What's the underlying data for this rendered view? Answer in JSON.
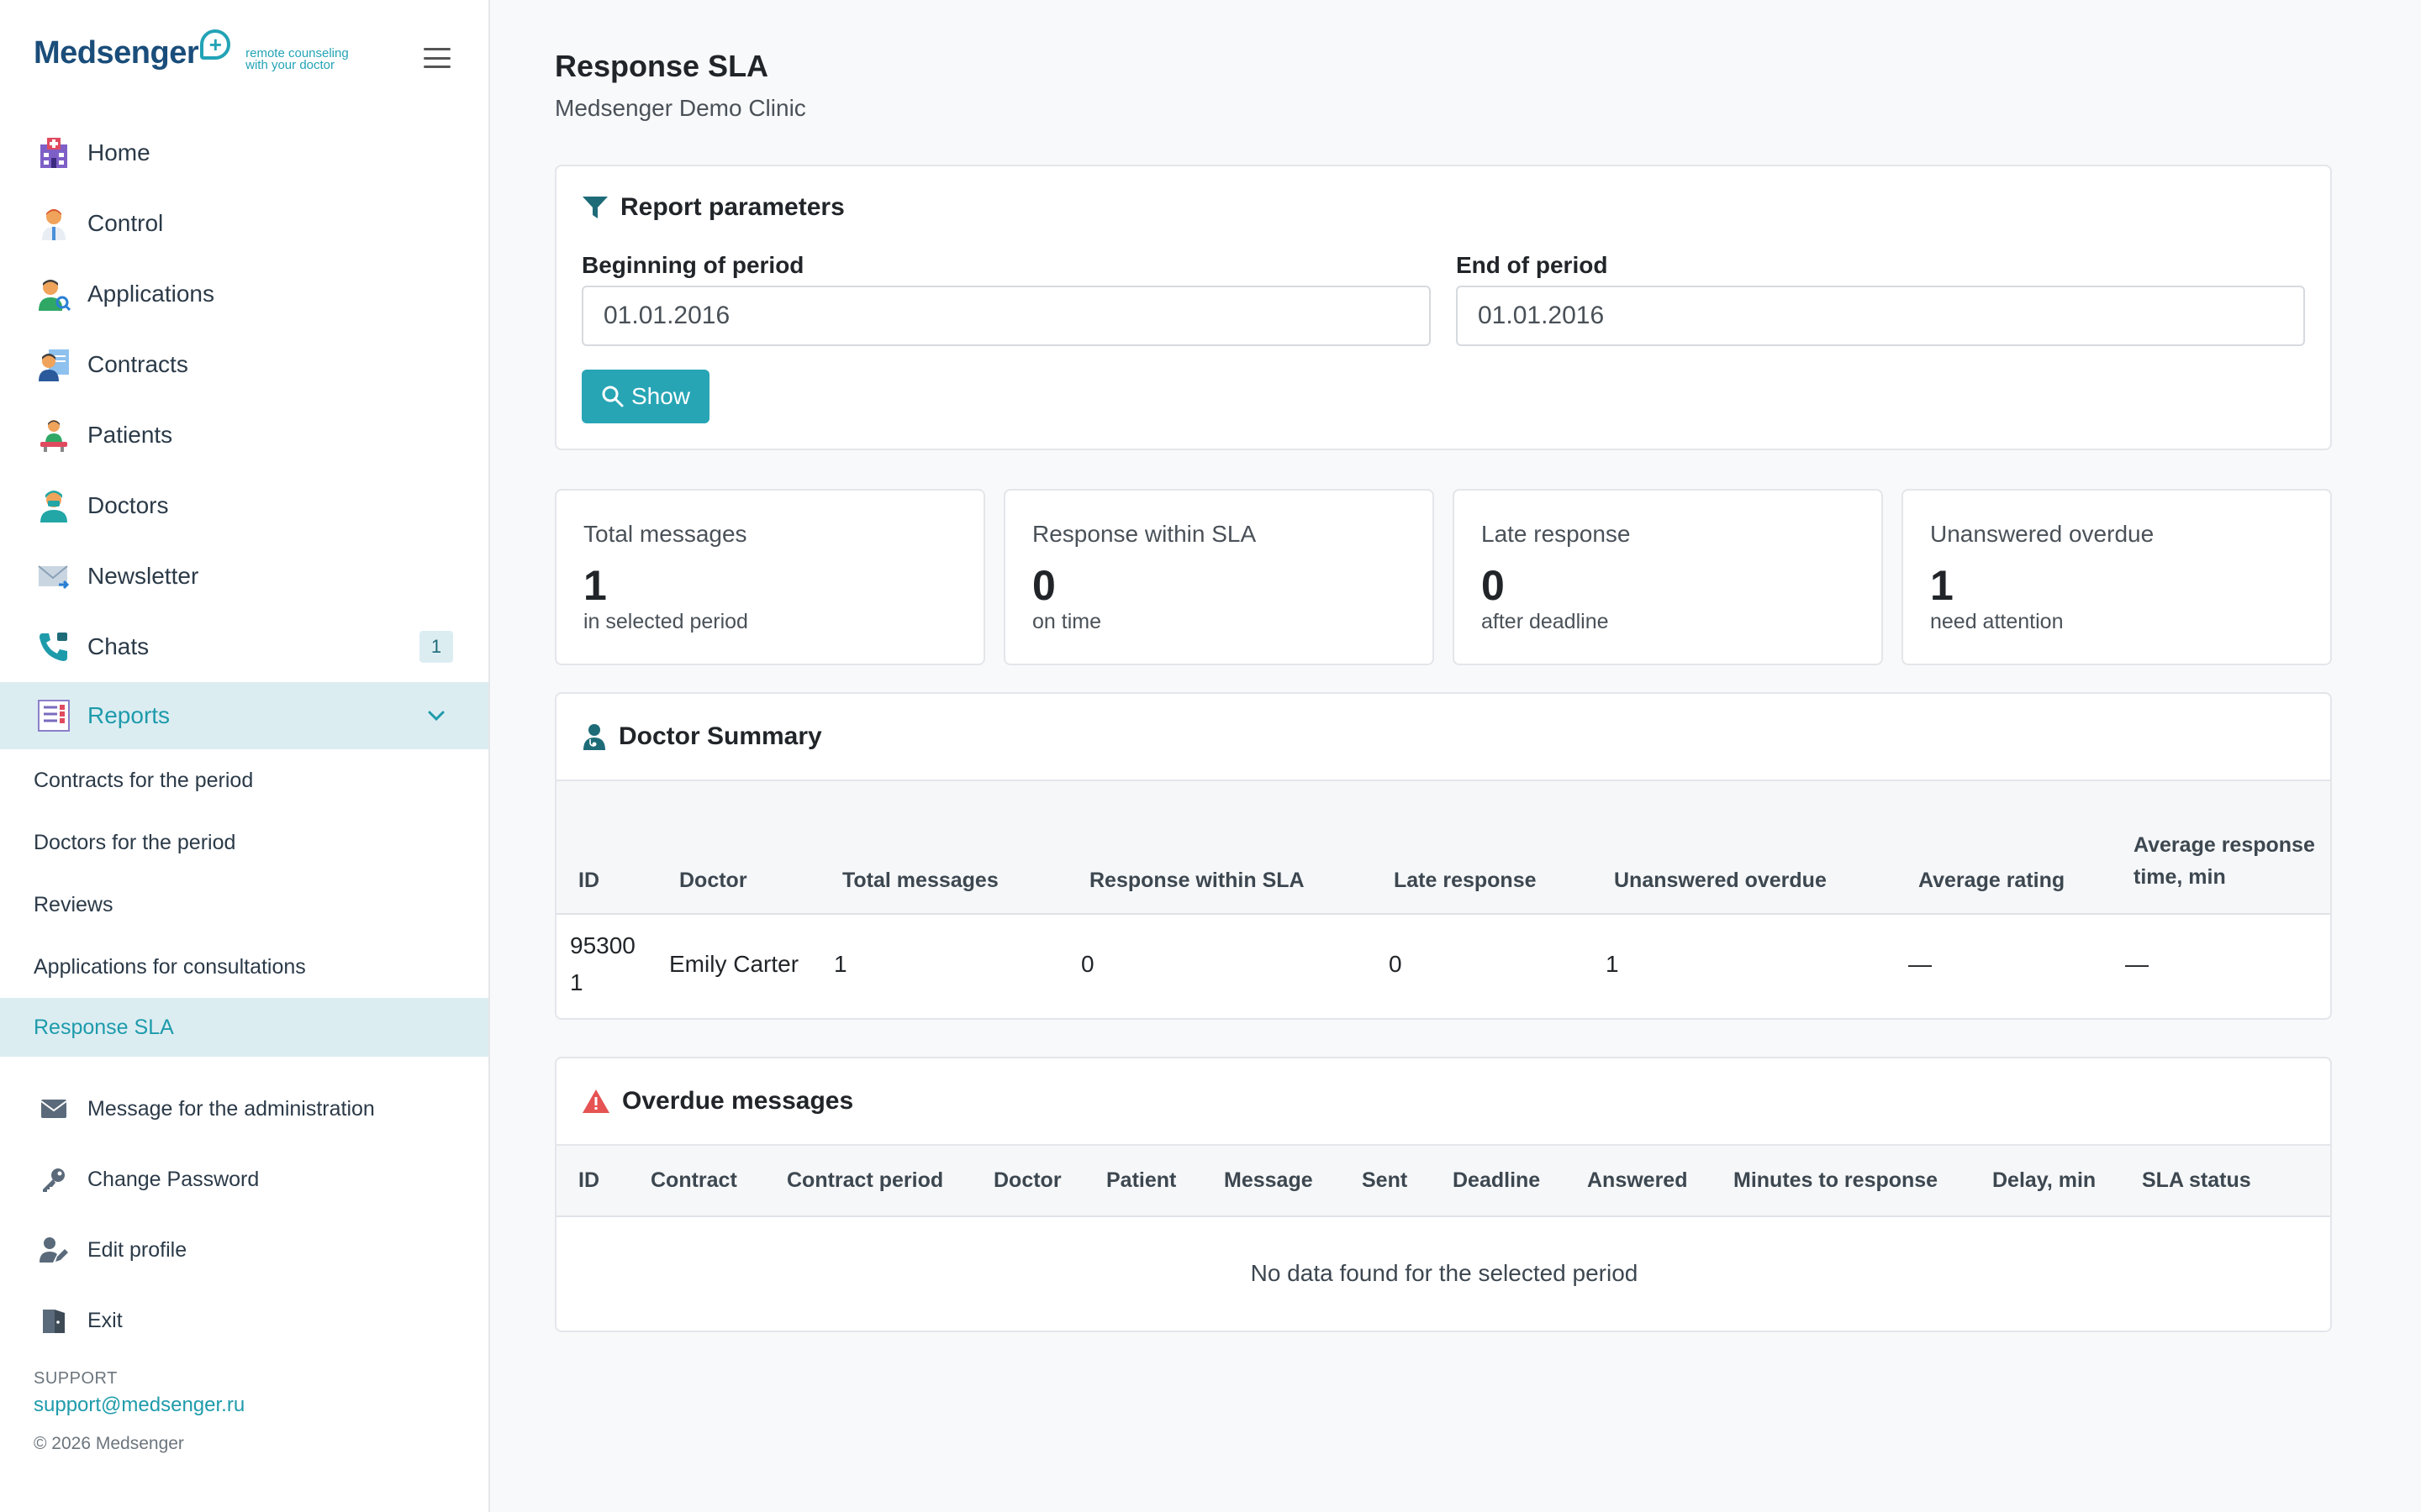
{
  "brand": {
    "name": "Medsenger",
    "plus": "+",
    "tagline_1": "remote counseling",
    "tagline_2": "with your doctor"
  },
  "nav": {
    "items": [
      {
        "label": "Home",
        "icon": "hospital-icon"
      },
      {
        "label": "Control",
        "icon": "doctor-icon"
      },
      {
        "label": "Applications",
        "icon": "user-search-icon"
      },
      {
        "label": "Contracts",
        "icon": "contract-icon"
      },
      {
        "label": "Patients",
        "icon": "patient-icon"
      },
      {
        "label": "Doctors",
        "icon": "surgeon-icon"
      },
      {
        "label": "Newsletter",
        "icon": "envelope-icon"
      },
      {
        "label": "Chats",
        "icon": "phone-icon",
        "badge": "1"
      },
      {
        "label": "Reports",
        "icon": "report-icon",
        "expanded": true
      }
    ],
    "report_subitems": [
      {
        "label": "Contracts for the period"
      },
      {
        "label": "Doctors for the period"
      },
      {
        "label": "Reviews"
      },
      {
        "label": "Applications for consultations"
      },
      {
        "label": "Response SLA",
        "active": true
      }
    ],
    "bottom_items": [
      {
        "label": "Message for the administration",
        "icon": "mail-icon"
      },
      {
        "label": "Change Password",
        "icon": "key-icon"
      },
      {
        "label": "Edit profile",
        "icon": "user-edit-icon"
      },
      {
        "label": "Exit",
        "icon": "door-icon"
      }
    ]
  },
  "support": {
    "label": "SUPPORT",
    "email": "support@medsenger.ru"
  },
  "copyright": "© 2026 Medsenger",
  "page": {
    "title": "Response SLA",
    "subtitle": "Medsenger Demo Clinic"
  },
  "params": {
    "title": "Report parameters",
    "begin_label": "Beginning of period",
    "begin_value": "01.01.2016",
    "end_label": "End of period",
    "end_value": "01.01.2016",
    "show_label": "Show"
  },
  "stats": [
    {
      "label": "Total messages",
      "value": "1",
      "sub": "in selected period"
    },
    {
      "label": "Response within SLA",
      "value": "0",
      "sub": "on time"
    },
    {
      "label": "Late response",
      "value": "0",
      "sub": "after deadline"
    },
    {
      "label": "Unanswered overdue",
      "value": "1",
      "sub": "need attention"
    }
  ],
  "doctor_summary": {
    "title": "Doctor Summary",
    "headers": [
      "ID",
      "Doctor",
      "Total messages",
      "Response within SLA",
      "Late response",
      "Unanswered overdue",
      "Average rating",
      "Average response time, min"
    ],
    "rows": [
      [
        "953001",
        "Emily Carter",
        "1",
        "0",
        "0",
        "1",
        "—",
        "—"
      ]
    ]
  },
  "overdue": {
    "title": "Overdue messages",
    "headers": [
      "ID",
      "Contract",
      "Contract period",
      "Doctor",
      "Patient",
      "Message",
      "Sent",
      "Deadline",
      "Answered",
      "Minutes to response",
      "Delay, min",
      "SLA status"
    ],
    "empty_text": "No data found for the selected period"
  },
  "colors": {
    "accent": "#27a5b5",
    "active_bg": "#dcedf2",
    "brand_dark": "#1a4d7a",
    "warning": "#e55353"
  }
}
